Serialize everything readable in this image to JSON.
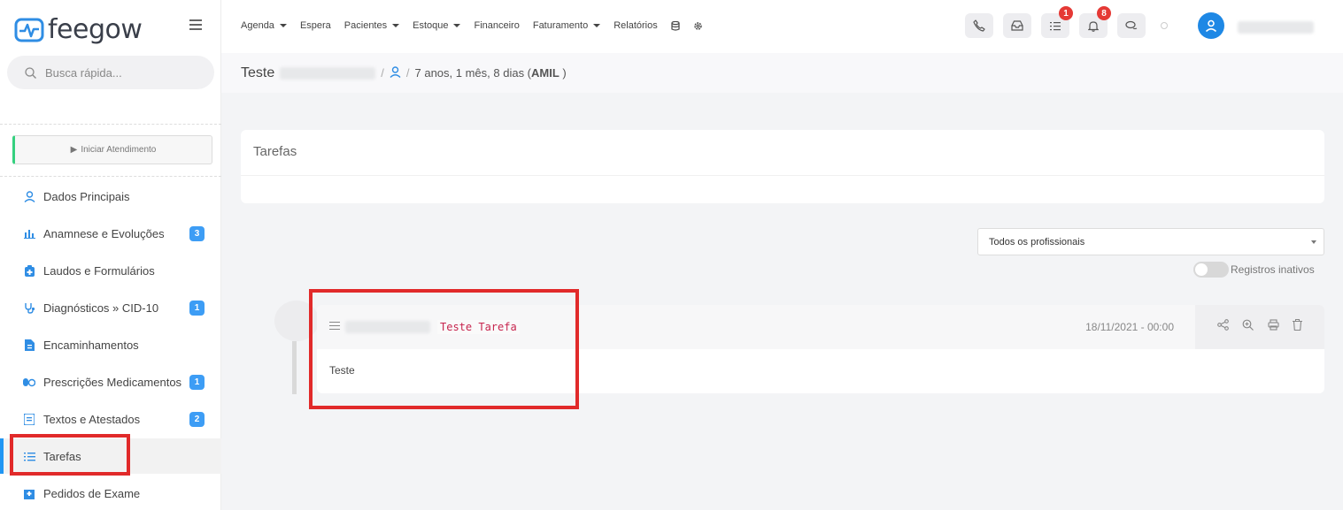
{
  "app": {
    "logo": "feegow"
  },
  "search": {
    "placeholder": "Busca rápida..."
  },
  "sidebar": {
    "start_label": "Iniciar Atendimento",
    "items": [
      {
        "label": "Dados Principais",
        "icon": "user-icon"
      },
      {
        "label": "Anamnese e Evoluções",
        "icon": "chart-icon",
        "badge": "3"
      },
      {
        "label": "Laudos e Formulários",
        "icon": "clipboard-icon"
      },
      {
        "label": "Diagnósticos » CID-10",
        "icon": "stethoscope-icon",
        "badge": "1"
      },
      {
        "label": "Encaminhamentos",
        "icon": "document-icon"
      },
      {
        "label": "Prescrições Medicamentos",
        "icon": "pills-icon",
        "badge": "1"
      },
      {
        "label": "Textos e Atestados",
        "icon": "certificate-icon",
        "badge": "2"
      },
      {
        "label": "Tarefas",
        "icon": "tasks-icon",
        "active": true
      },
      {
        "label": "Pedidos de Exame",
        "icon": "hospital-icon"
      }
    ]
  },
  "topnav": {
    "items": [
      {
        "label": "Agenda",
        "dropdown": true
      },
      {
        "label": "Espera"
      },
      {
        "label": "Pacientes",
        "dropdown": true
      },
      {
        "label": "Estoque",
        "dropdown": true
      },
      {
        "label": "Financeiro"
      },
      {
        "label": "Faturamento",
        "dropdown": true
      },
      {
        "label": "Relatórios"
      }
    ],
    "tasks_count": "1",
    "notifications_count": "8"
  },
  "breadcrumb": {
    "title": "Teste",
    "separator": "/",
    "patient_info": "7 anos, 1 mês, 8 dias (",
    "plan": "AMIL",
    "close_paren": " )"
  },
  "tasks_panel": {
    "title": "Tarefas"
  },
  "filter": {
    "selected": "Todos os profissionais",
    "toggle_label": "Registros inativos"
  },
  "task": {
    "title": "Teste Tarefa",
    "date": "18/11/2021 - 00:00",
    "body": "Teste"
  },
  "colors": {
    "accent": "#2196f3",
    "badge": "#3d9df5",
    "notification": "#e53935",
    "highlight_box": "#e12a2a",
    "start_border": "#35d07f"
  }
}
